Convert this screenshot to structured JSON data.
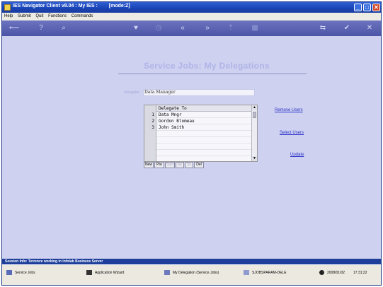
{
  "window": {
    "title": "IES Navigator Client v8.04 : My IES :",
    "mode": "[mode:Z]",
    "controls": {
      "minimize": "_",
      "maximize": "□",
      "close": "✕"
    }
  },
  "menu": [
    "Help",
    "Submit",
    "Quit",
    "Functions",
    "Commands"
  ],
  "toolbar": [
    "⟵",
    "?",
    "⌕",
    "♥",
    "◷",
    "«",
    "»",
    "⇡",
    "▦",
    "⇆",
    "✔",
    "✕"
  ],
  "page": {
    "heading": "Service Jobs: My Delegations",
    "delegator_label": "Delegator",
    "delegator_value": "Data Manager"
  },
  "grid": {
    "column": "Delegate To",
    "rows": [
      {
        "num": "1",
        "name": "Data Mngr"
      },
      {
        "num": "2",
        "name": "Gordon Blomeau"
      },
      {
        "num": "3",
        "name": "John Smith"
      }
    ],
    "scroll_up": "▲",
    "scroll_down": "▼",
    "nav": [
      "New",
      "Pre",
      "Sold",
      "Nx",
      "Sv",
      "Del"
    ]
  },
  "links": {
    "remove": "Remove Users",
    "select": "Select Users",
    "update": "Update"
  },
  "session": "Session Info: Terrence working in Infolab Business Server",
  "status": {
    "items": [
      "Service Jobs",
      "Application Wizard",
      "My Delegation (Service Jobs)",
      "SJOBSPARAM-DELE"
    ],
    "date": "2008/01/02",
    "time": "17:31:22"
  },
  "colors": {
    "titlebar": "#1943b4",
    "background": "#ced1ef",
    "link": "#2b31c9",
    "heading": "#b0b4e8"
  }
}
